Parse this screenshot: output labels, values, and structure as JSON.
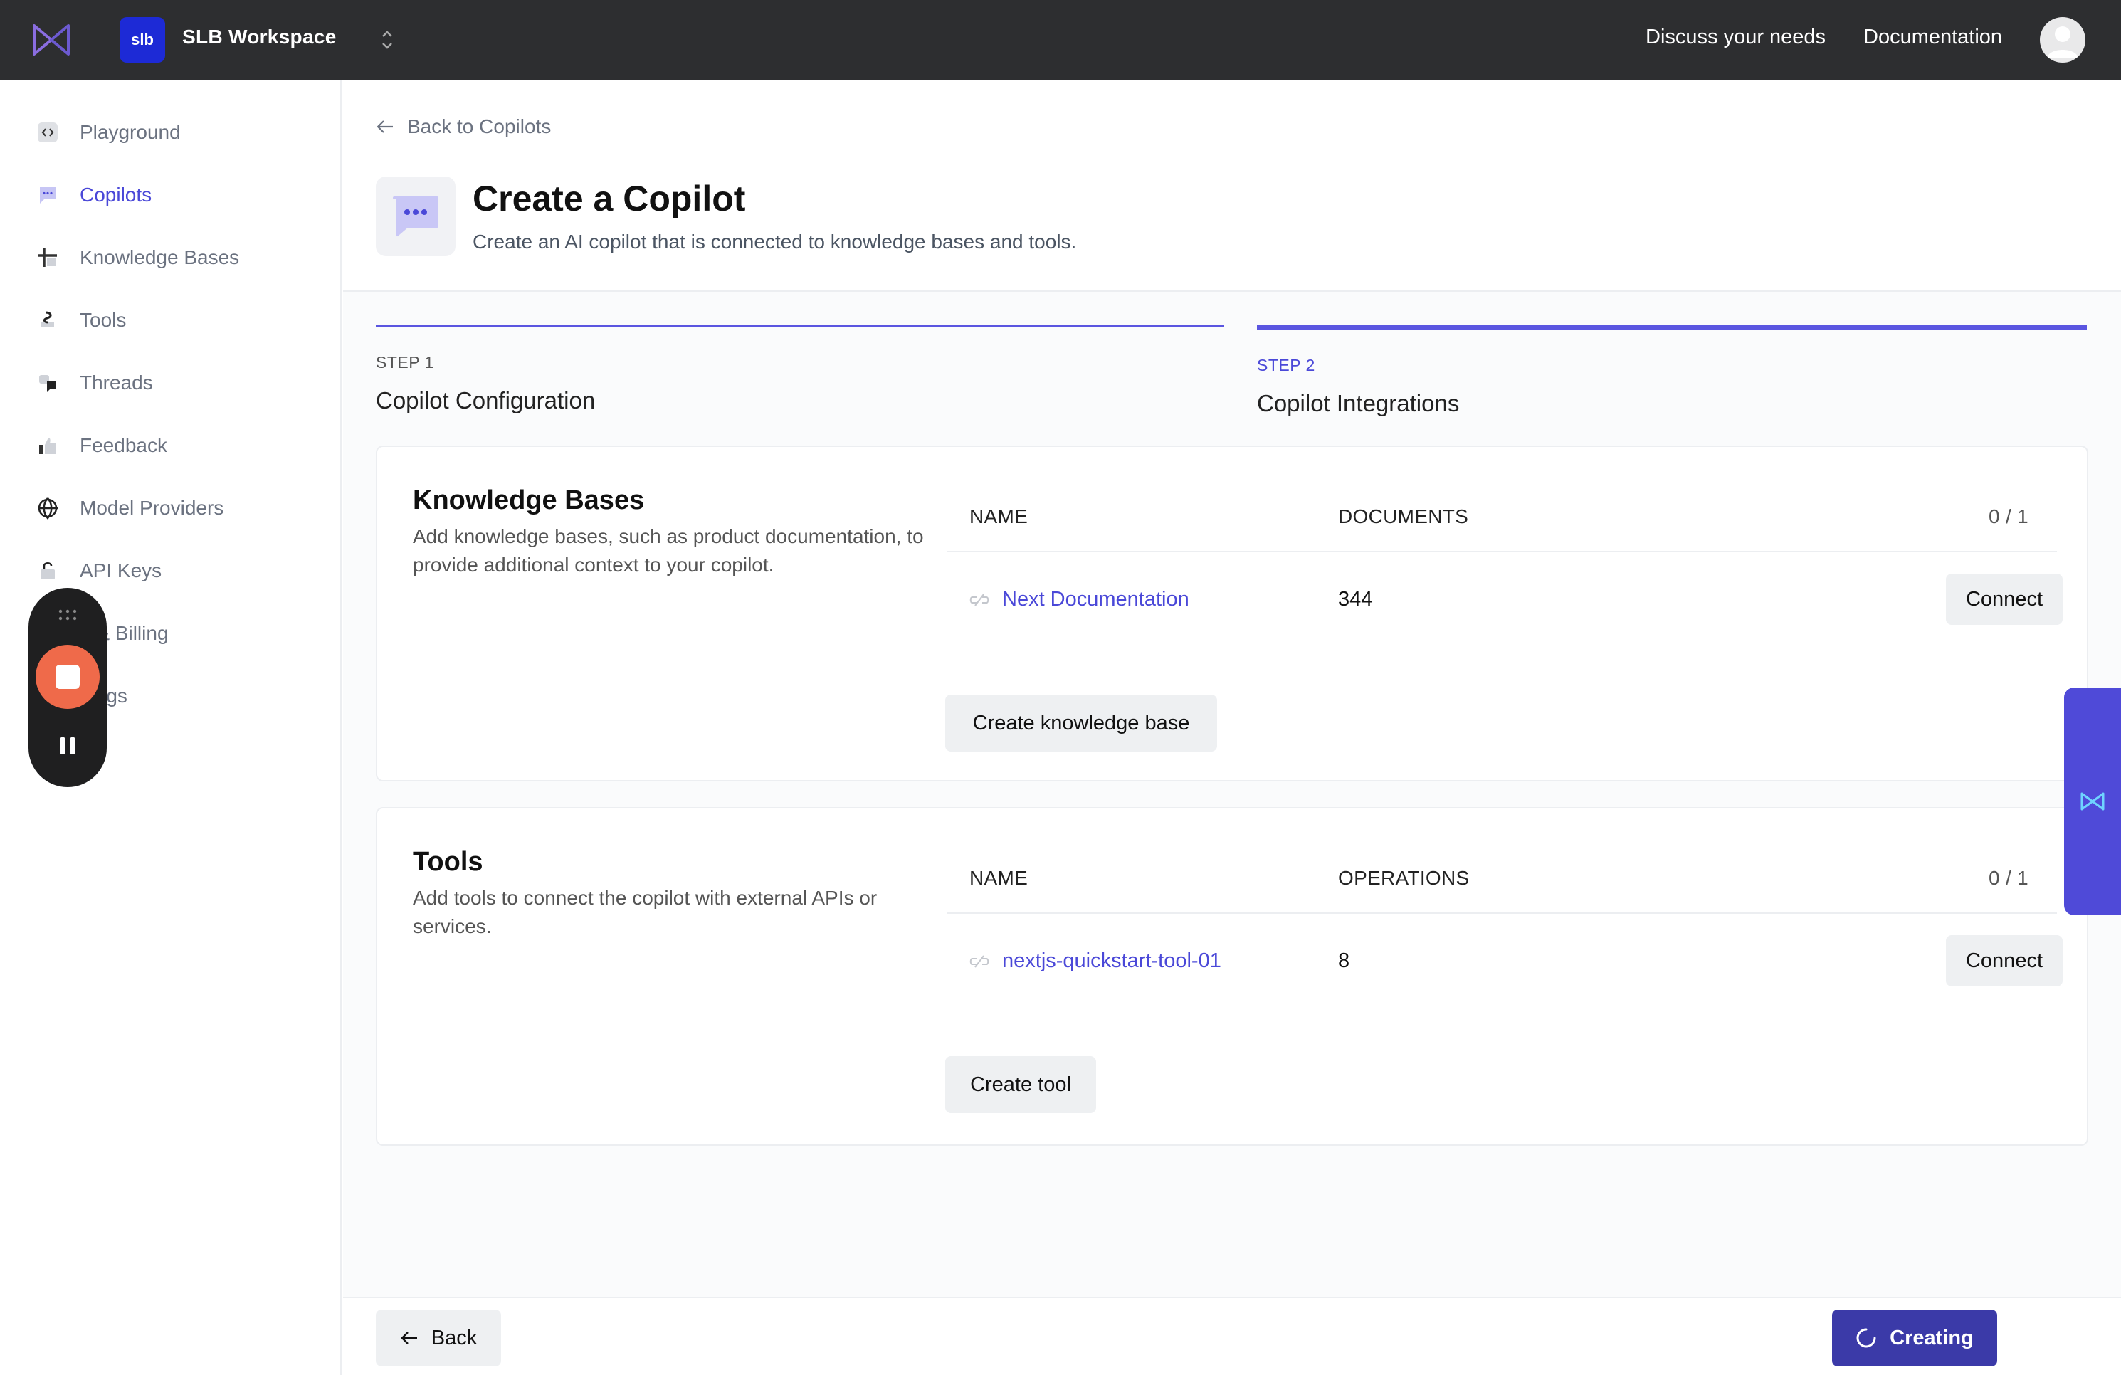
{
  "topbar": {
    "workspace_badge": "slb",
    "workspace_name": "SLB Workspace",
    "links": [
      "Discuss your needs",
      "Documentation"
    ]
  },
  "sidebar": {
    "items": [
      {
        "label": "Playground",
        "icon": "code-icon"
      },
      {
        "label": "Copilots",
        "icon": "chat-bubble-icon",
        "active": true
      },
      {
        "label": "Knowledge Bases",
        "icon": "grid-hash-icon"
      },
      {
        "label": "Tools",
        "icon": "plug-icon"
      },
      {
        "label": "Threads",
        "icon": "threads-icon"
      },
      {
        "label": "Feedback",
        "icon": "thumbs-up-icon"
      },
      {
        "label": "Model Providers",
        "icon": "globe-icon"
      },
      {
        "label": "API Keys",
        "icon": "lock-icon"
      },
      {
        "label": "n & Billing",
        "icon": ""
      },
      {
        "label": "ttings",
        "icon": ""
      }
    ]
  },
  "header": {
    "back_label": "Back to Copilots",
    "title": "Create a Copilot",
    "subtitle": "Create an AI copilot that is connected to knowledge bases and tools."
  },
  "steps": [
    {
      "num": "STEP 1",
      "name": "Copilot Configuration"
    },
    {
      "num": "STEP 2",
      "name": "Copilot Integrations",
      "active": true
    }
  ],
  "knowledge_bases": {
    "title": "Knowledge Bases",
    "description": "Add knowledge bases, such as product documentation, to provide additional context to your copilot.",
    "col_name": "NAME",
    "col_count": "DOCUMENTS",
    "count": "0 / 1",
    "rows": [
      {
        "name": "Next Documentation",
        "value": "344",
        "action": "Connect"
      }
    ],
    "create_label": "Create knowledge base"
  },
  "tools": {
    "title": "Tools",
    "description": "Add tools to connect the copilot with external APIs or services.",
    "col_name": "NAME",
    "col_count": "OPERATIONS",
    "count": "0 / 1",
    "rows": [
      {
        "name": "nextjs-quickstart-tool-01",
        "value": "8",
        "action": "Connect"
      }
    ],
    "create_label": "Create tool"
  },
  "footer": {
    "back_label": "Back",
    "creating_label": "Creating"
  },
  "colors": {
    "accent": "#4a48d8",
    "topbar": "#2d2e30",
    "record": "#ef6a4a"
  }
}
